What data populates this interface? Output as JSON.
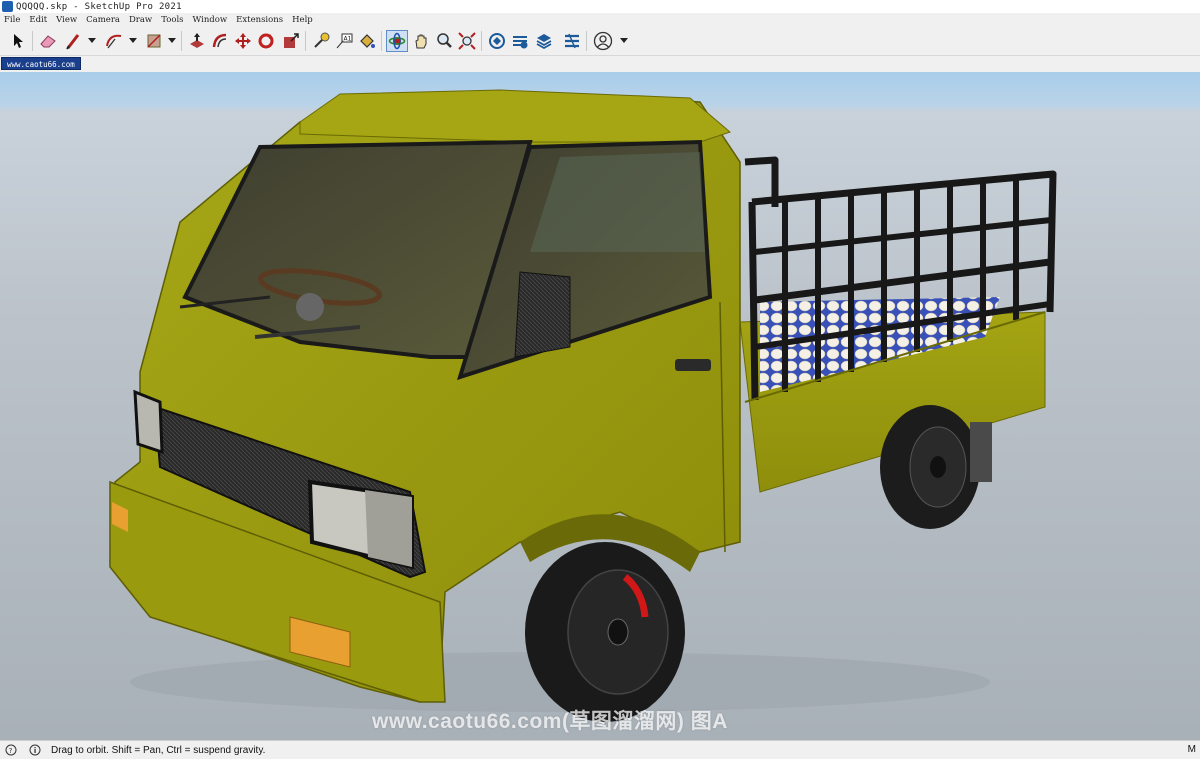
{
  "window": {
    "title": "QQQQQ.skp - SketchUp Pro 2021"
  },
  "menu": [
    {
      "label": "File"
    },
    {
      "label": "Edit"
    },
    {
      "label": "View"
    },
    {
      "label": "Camera"
    },
    {
      "label": "Draw"
    },
    {
      "label": "Tools"
    },
    {
      "label": "Window"
    },
    {
      "label": "Extensions"
    },
    {
      "label": "Help"
    }
  ],
  "toolbar": {
    "tools": [
      {
        "icon": "select-arrow-icon"
      },
      {
        "icon": "eraser-icon"
      },
      {
        "icon": "pencil-line-icon"
      },
      {
        "icon": "arc-icon"
      },
      {
        "icon": "rectangle-icon"
      },
      {
        "icon": "push-pull-icon"
      },
      {
        "icon": "offset-icon"
      },
      {
        "icon": "move-icon"
      },
      {
        "icon": "rotate-icon"
      },
      {
        "icon": "scale-icon"
      },
      {
        "icon": "tape-measure-icon"
      },
      {
        "icon": "text-icon"
      },
      {
        "icon": "paint-bucket-icon"
      },
      {
        "icon": "orbit-icon"
      },
      {
        "icon": "pan-icon"
      },
      {
        "icon": "zoom-icon"
      },
      {
        "icon": "zoom-extents-icon"
      },
      {
        "icon": "3d-warehouse-icon"
      },
      {
        "icon": "extension-warehouse-icon"
      },
      {
        "icon": "layout-icon"
      },
      {
        "icon": "extension-manager-icon"
      },
      {
        "icon": "profile-icon"
      }
    ],
    "active_tool": "orbit-icon"
  },
  "scene_tab": {
    "label": "www.caotu66.com"
  },
  "viewport": {
    "watermark": "www.caotu66.com(草图溜溜网) 图A"
  },
  "status": {
    "message": "Drag to orbit. Shift = Pan, Ctrl = suspend gravity.",
    "measurements_label": "M"
  },
  "colors": {
    "truck_body": "#9a9a10",
    "sky": "#a9cdea",
    "ground": "#b4bcc4",
    "scene_tab": "#1a3f8c"
  }
}
